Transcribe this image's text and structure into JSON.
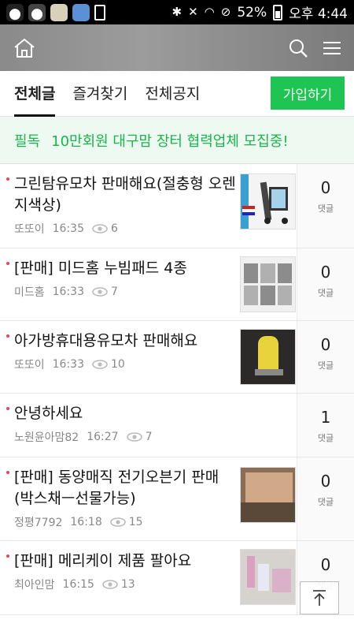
{
  "status_bar": {
    "battery": "52%",
    "clock": "오후 4:44"
  },
  "header": {
    "home_icon": "home-icon",
    "search_icon": "search-icon",
    "menu_icon": "hamburger-menu-icon"
  },
  "tabs": [
    {
      "label": "전체글",
      "active": true
    },
    {
      "label": "즐겨찾기",
      "active": false
    },
    {
      "label": "전체공지",
      "active": false
    }
  ],
  "join_button": "가입하기",
  "notice": {
    "tag": "필독",
    "text": "10만회원 대구맘 장터 협력업체 모집중!"
  },
  "comment_label": "댓글",
  "posts": [
    {
      "title": "그린탐유모차 판매해요(절충형 오렌지색상)",
      "author": "또또이",
      "time": "16:35",
      "views": "6",
      "comments": "0",
      "thumb": "stroller-ad-image"
    },
    {
      "title": "[판매] 미드홈 누빔패드 4종",
      "author": "미드홈",
      "time": "16:33",
      "views": "7",
      "comments": "0",
      "thumb": "quilted-pad-image"
    },
    {
      "title": "아가방휴대용유모차 판매해요",
      "author": "또또이",
      "time": "16:33",
      "views": "10",
      "comments": "0",
      "thumb": "yellow-stroller-image"
    },
    {
      "title": "안녕하세요",
      "author": "노원윤아맘82",
      "time": "16:27",
      "views": "7",
      "comments": "1",
      "thumb": ""
    },
    {
      "title": "[판매] 동양매직 전기오븐기 판매(박스채ㅡ선물가능)",
      "author": "정평7792",
      "time": "16:18",
      "views": "15",
      "comments": "0",
      "thumb": "oven-box-image"
    },
    {
      "title": "[판매] 메리케이 제품 팔아요",
      "author": "최아인맘",
      "time": "16:15",
      "views": "13",
      "comments": "0",
      "thumb": "cosmetics-image"
    }
  ]
}
